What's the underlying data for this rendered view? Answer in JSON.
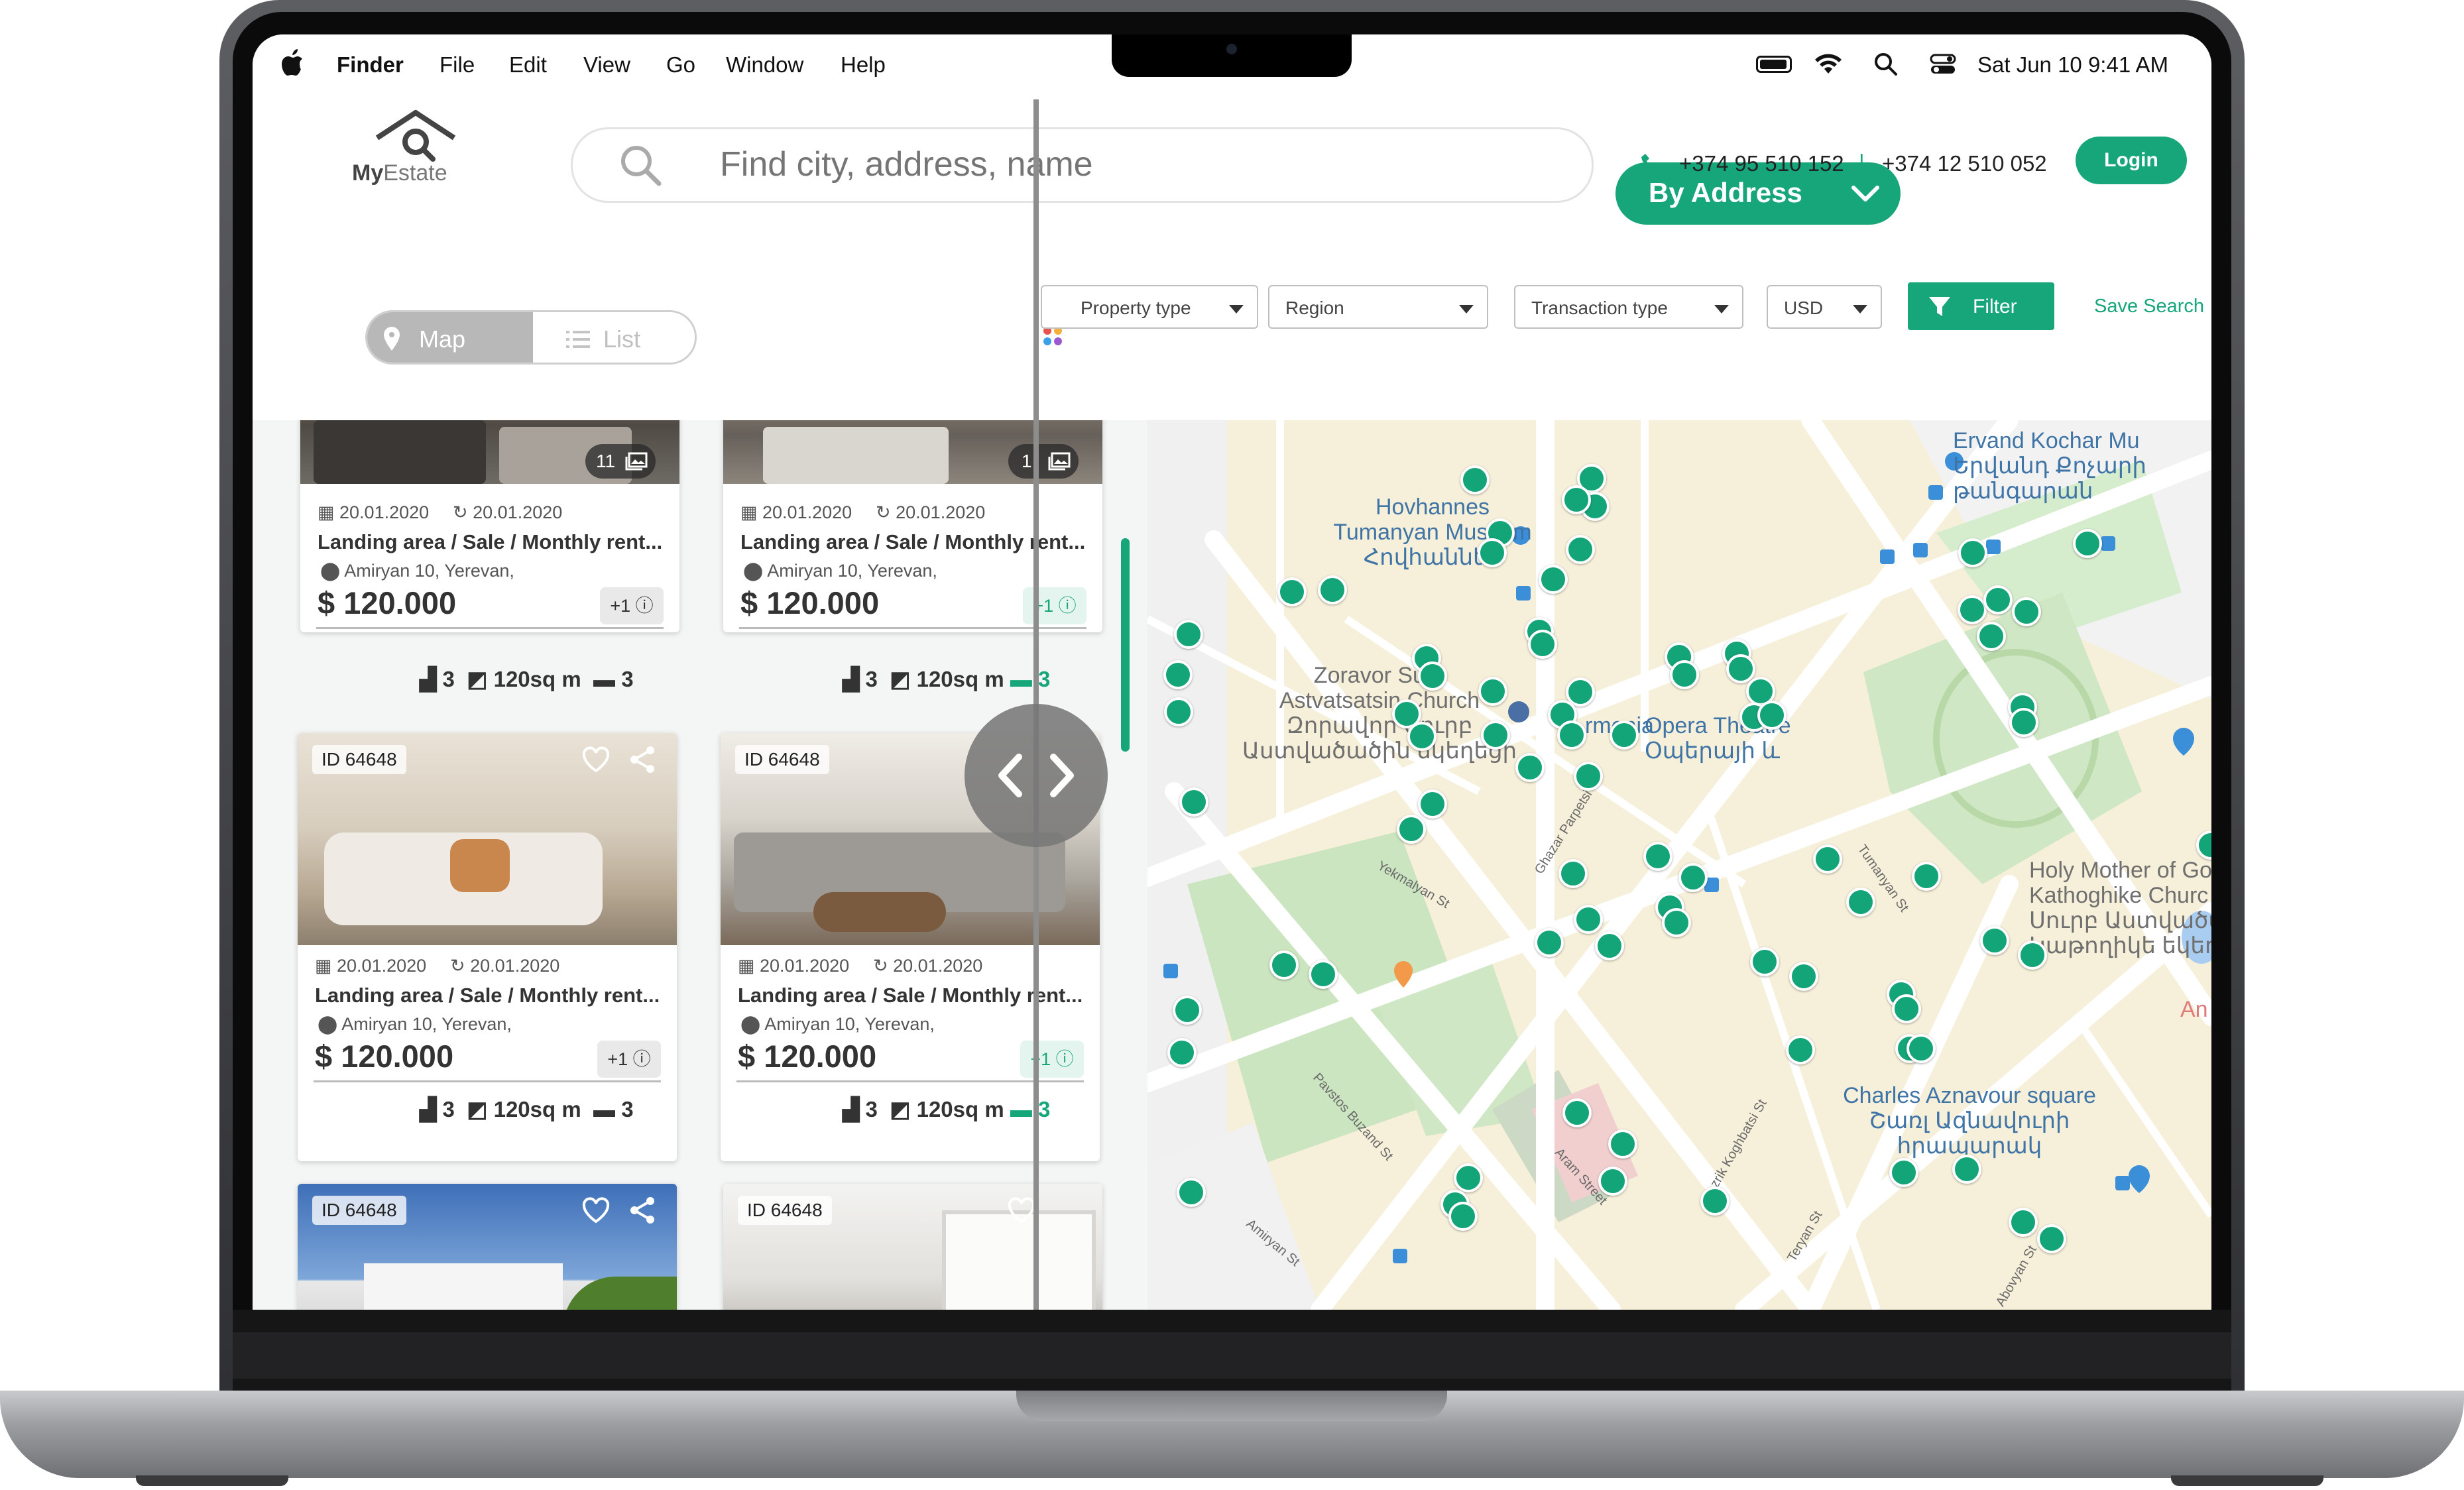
{
  "menubar": {
    "app": "Finder",
    "menus": [
      "File",
      "Edit",
      "View",
      "Go",
      "Window",
      "Help"
    ],
    "datetime": "Sat Jun 10  9:41 AM"
  },
  "logo": {
    "text_bold": "My",
    "text_regular": "Estate"
  },
  "search": {
    "placeholder": "Find city, address, name",
    "mode": "By Address"
  },
  "contact": {
    "phone1": "+374 95 510 152",
    "separator": "|",
    "phone2": "+374 12 510 052"
  },
  "login_label": "Login",
  "view_toggle": {
    "map": "Map",
    "list": "List",
    "active": "Map"
  },
  "filters": {
    "property_type": "Property type",
    "region": "Region",
    "transaction_type": "Transaction type",
    "currency": "USD",
    "filter_button": "Filter",
    "save_search": "Save Search"
  },
  "cards": [
    {
      "photo_count": "11",
      "created": "20.01.2020",
      "updated": "20.01.2020",
      "title": "Landing area / Sale / Monthly rent...",
      "address": "Amiryan 10, Yerevan,",
      "price": "$ 120.000",
      "extra": "+1",
      "floors": "3",
      "area": "120sq m",
      "beds": "3"
    },
    {
      "photo_count": "1",
      "created": "20.01.2020",
      "updated": "20.01.2020",
      "title": "Landing area / Sale / Monthly rent...",
      "address": "Amiryan 10, Yerevan,",
      "price": "$ 120.000",
      "extra": "+1",
      "floors": "3",
      "area": "120sq m",
      "beds": "3"
    },
    {
      "id": "ID 64648",
      "created": "20.01.2020",
      "updated": "20.01.2020",
      "title": "Landing area / Sale / Monthly rent...",
      "address": "Amiryan 10, Yerevan,",
      "price": "$ 120.000",
      "extra": "+1",
      "floors": "3",
      "area": "120sq m",
      "beds": "3"
    },
    {
      "id": "ID 64648",
      "created": "20.01.2020",
      "updated": "20.01.2020",
      "title": "Landing area / Sale / Monthly rent...",
      "address": "Amiryan 10, Yerevan,",
      "price": "$ 120.000",
      "extra": "+1",
      "floors": "3",
      "area": "120sq m",
      "beds": "3"
    },
    {
      "id": "ID 64648"
    },
    {
      "id": "ID 64648"
    }
  ],
  "map": {
    "places": {
      "museum": "Hovhannes\nTumanyan Museum\nՀովհաննես",
      "church": "Zoravor Surp\nAstvatsatsin Church\nԶորավոր Սուրբ\nԱստվածածին եկեղեցի",
      "opera": "Opera Theatre\nՕպերայի և",
      "armenia": "rmenia",
      "kochar": "Ervand Kochar Mu\nԵրվանդ Քոչարի\nթանգարան",
      "holy": "Holy Mother of Go\nKathoghike Churc\nՍուրբ Աստվածած\nԿաթողիկե եկեղեց",
      "aznavour": "Charles Aznavour square\nՇառլ Ազնավուրի\nհրապարակ",
      "an": "An"
    },
    "streets": [
      "Ghazar Parpetsi St",
      "Tumanyan St",
      "Parpetsi St",
      "Yekmalyan St",
      "Pavstos Buzand St",
      "Aram Street",
      "Yezrik Koghbatsi St",
      "Amiryan St",
      "Teryan St",
      "Abovyan St"
    ]
  },
  "colors": {
    "brand": "#16a67a",
    "map_pin": "#13a578",
    "map_label": "#3f74a6",
    "map_bg": "#f6efd9"
  }
}
